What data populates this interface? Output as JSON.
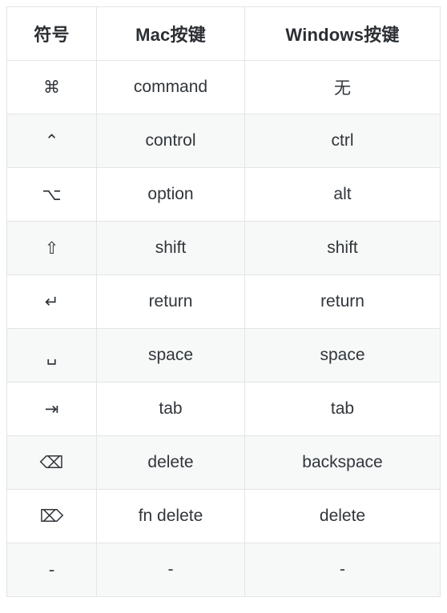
{
  "table": {
    "headers": [
      {
        "label": "符号"
      },
      {
        "label": "Mac按键"
      },
      {
        "label": "Windows按键"
      }
    ],
    "rows": [
      {
        "symbol": "⌘",
        "symbol_name": "command-symbol",
        "mac": "command",
        "windows": "无"
      },
      {
        "symbol": "⌃",
        "symbol_name": "control-symbol",
        "mac": "control",
        "windows": "ctrl"
      },
      {
        "symbol": "⌥",
        "symbol_name": "option-symbol",
        "mac": "option",
        "windows": "alt"
      },
      {
        "symbol": "⇧",
        "symbol_name": "shift-symbol",
        "mac": "shift",
        "windows": "shift"
      },
      {
        "symbol": "↵",
        "symbol_name": "return-symbol",
        "mac": "return",
        "windows": "return"
      },
      {
        "symbol": "␣",
        "symbol_name": "space-symbol",
        "mac": "space",
        "windows": "space"
      },
      {
        "symbol": "⇥",
        "symbol_name": "tab-symbol",
        "mac": "tab",
        "windows": "tab"
      },
      {
        "symbol": "⌫",
        "symbol_name": "delete-symbol",
        "mac": "delete",
        "windows": "backspace"
      },
      {
        "symbol": "⌦",
        "symbol_name": "fn-delete-symbol",
        "mac": "fn delete",
        "windows": "delete"
      },
      {
        "symbol": "-",
        "symbol_name": "placeholder-symbol",
        "mac": "-",
        "windows": "-"
      }
    ]
  },
  "colors": {
    "border": "#e2e4e6",
    "row_stripe": "#f7f8f8",
    "row_plain": "#ffffff",
    "text": "#31363b",
    "header_text": "#2b2f33"
  }
}
